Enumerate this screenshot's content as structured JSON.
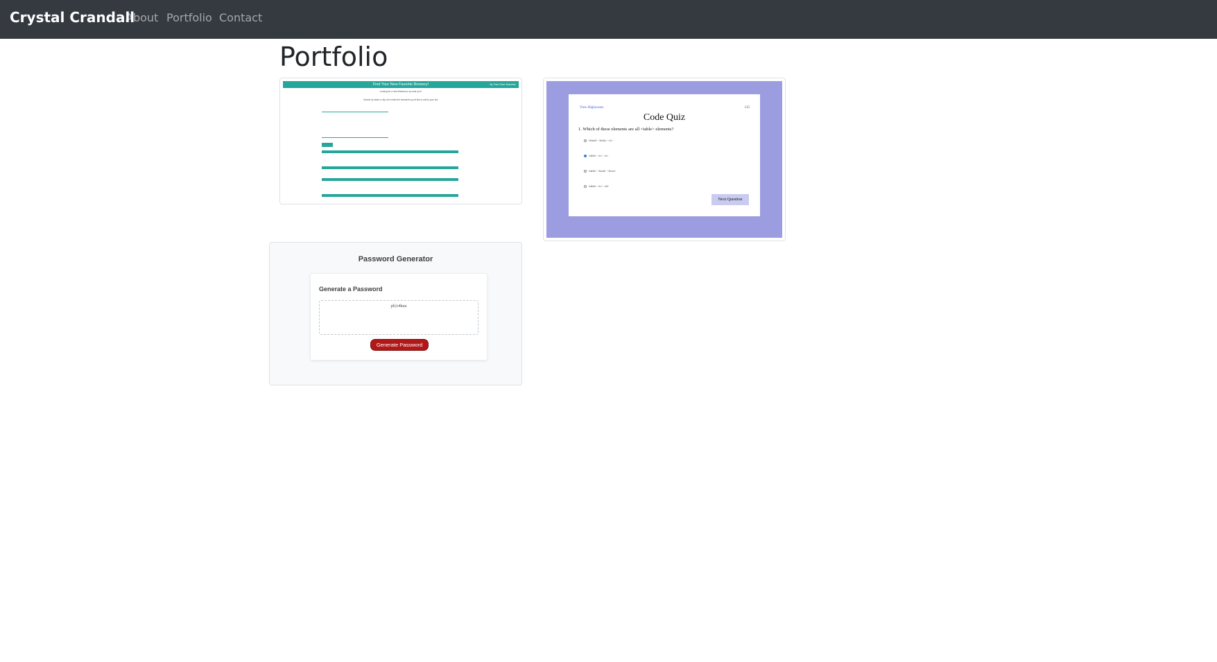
{
  "nav": {
    "brand": "Crystal Crandall",
    "links": [
      "About",
      "Portfolio",
      "Contact"
    ]
  },
  "page_title": "Portfolio",
  "projects": {
    "brewery": {
      "header": "Find Your New Favorite Brewery!",
      "links": "My Past   Clear Searches",
      "intro1": "Looking for a new Brewery to try near you?",
      "intro2": "Search by state or city, then enter the breweries you'd like to add to your list.",
      "button": "Search"
    },
    "quiz": {
      "highscores": "View Highscores",
      "timer": "115",
      "title": "Code Quiz",
      "question": "1. Which of these elements are all <table> elements?",
      "options": [
        "<thead> <body> <tr>",
        "<table> <tr> <tr>",
        "<table> <head> <tfoot>",
        "<table> <tr> <td>"
      ],
      "selected_index": 1,
      "next_button": "Next Question"
    },
    "password": {
      "title": "Password Generator",
      "subtitle": "Generate a Password",
      "value": "pb}r4kuu",
      "button": "Generate Password"
    }
  },
  "colors": {
    "navbar": "#343a40",
    "brewery_accent": "#26a69a",
    "quiz_background": "#9b9de0",
    "password_button": "#b21818"
  }
}
